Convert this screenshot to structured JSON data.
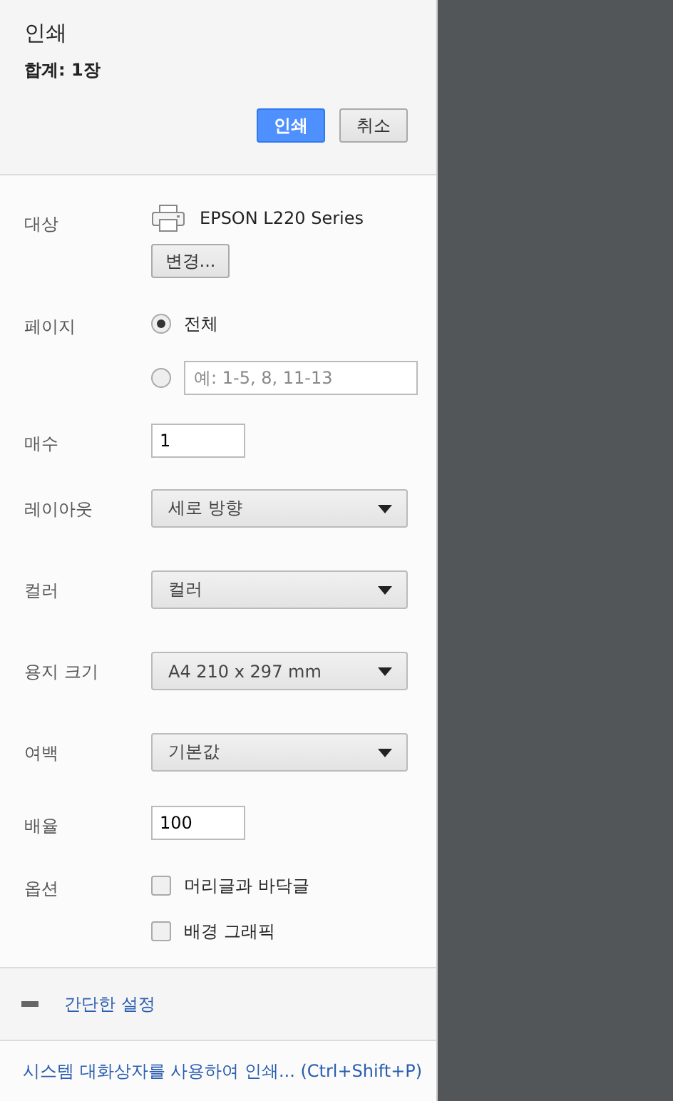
{
  "header": {
    "title": "인쇄",
    "total": "합계: 1장",
    "buttons": [
      {
        "label": "인쇄",
        "kind": "primary"
      },
      {
        "label": "취소",
        "kind": "secondary"
      }
    ]
  },
  "settings": [
    {
      "kind": "destination",
      "label": "대상",
      "printer": "EPSON L220 Series",
      "button": "변경..."
    },
    {
      "kind": "pages",
      "label": "페이지",
      "options": [
        {
          "text": "전체",
          "selected": true
        },
        {
          "placeholder": "예: 1-5, 8, 11-13",
          "selected": false
        }
      ]
    },
    {
      "kind": "number",
      "label": "매수",
      "value": "1"
    },
    {
      "kind": "select",
      "label": "레이아웃",
      "value": "세로 방향"
    },
    {
      "kind": "select",
      "label": "컬러",
      "value": "컬러"
    },
    {
      "kind": "select",
      "label": "용지 크기",
      "value": "A4 210 x 297 mm"
    },
    {
      "kind": "select",
      "label": "여백",
      "value": "기본값"
    },
    {
      "kind": "number",
      "label": "배율",
      "value": "100"
    },
    {
      "kind": "options",
      "label": "옵션",
      "items": [
        {
          "text": "머리글과 바닥글",
          "checked": false
        },
        {
          "text": "배경 그래픽",
          "checked": false
        }
      ]
    }
  ],
  "toggle": {
    "label": "간단한 설정",
    "expanded": true
  },
  "system_link": "시스템 대화상자를 사용하여 인쇄... (Ctrl+Shift+P)"
}
